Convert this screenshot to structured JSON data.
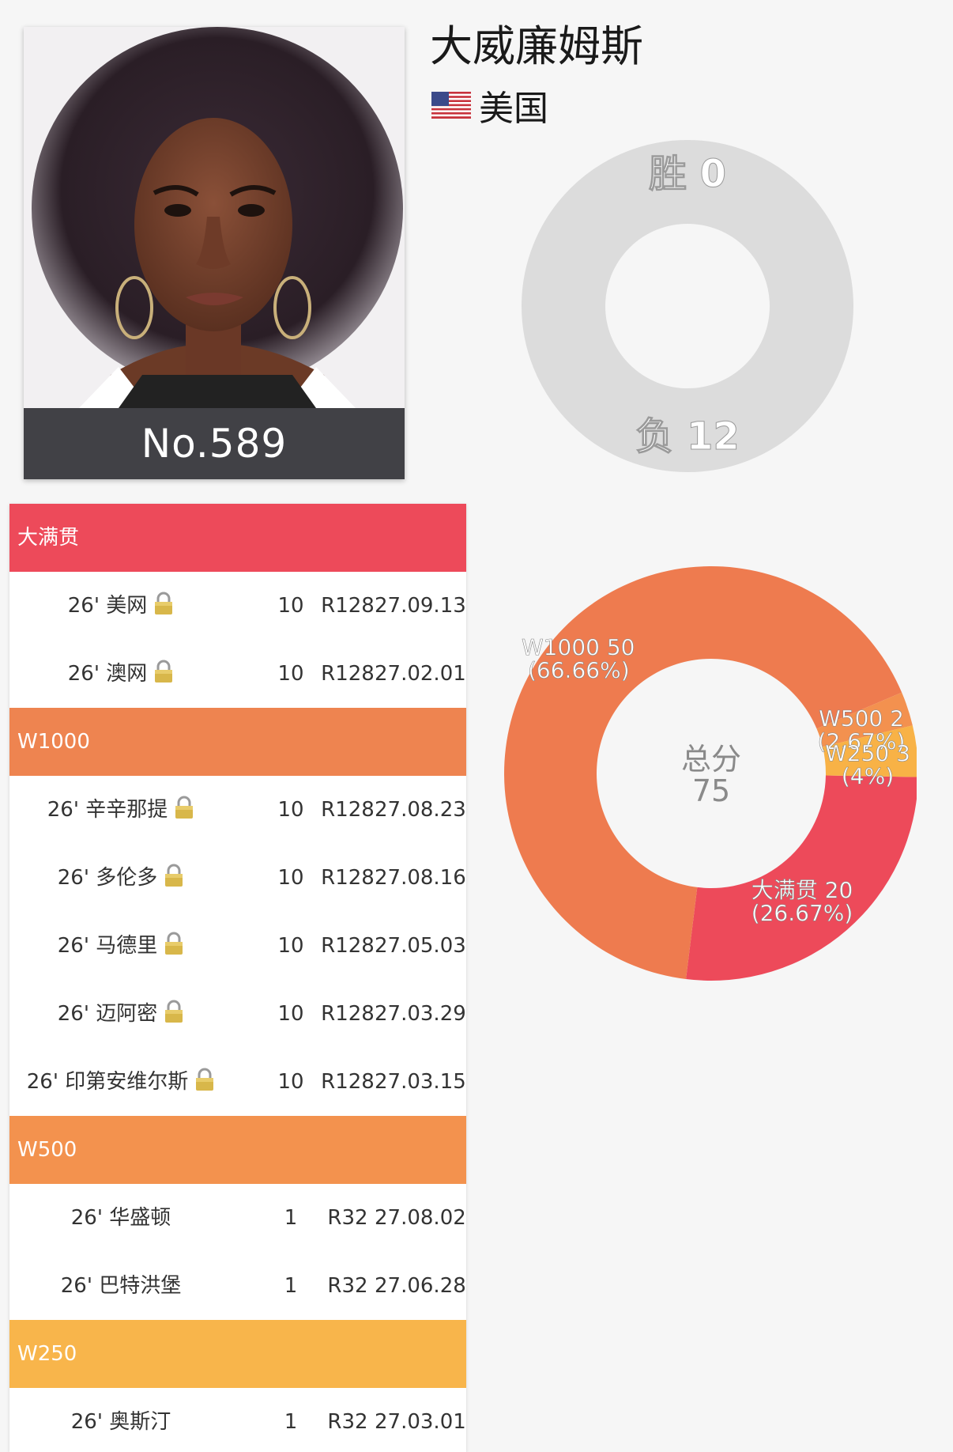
{
  "player": {
    "name": "大威廉姆斯",
    "country": "美国",
    "rank_label": "No.589"
  },
  "record": {
    "wins_label": "胜 0",
    "losses_label": "负 12",
    "wins": 0,
    "losses": 12,
    "color": "#dcdcdc"
  },
  "points_chart": {
    "center_label": "总分",
    "center_value": "75"
  },
  "chart_data": {
    "type": "pie",
    "center_label": "总分",
    "center_value": "75",
    "slices": [
      {
        "name": "W1000",
        "value": 50,
        "label": "W1000 50",
        "pct": "(66.66%)",
        "color": "#ee7b4f"
      },
      {
        "name": "W500",
        "value": 2,
        "label": "W500 2",
        "pct": "(2.67%)",
        "color": "#f3914f"
      },
      {
        "name": "W250",
        "value": 3,
        "label": "W250 3",
        "pct": "(4%)",
        "color": "#f8b246"
      },
      {
        "name": "大满贯",
        "value": 20,
        "label": "大满贯 20",
        "pct": "(26.67%)",
        "color": "#ed4a5a"
      }
    ]
  },
  "categories": [
    {
      "name": "大满贯",
      "color": "#ed4a5a",
      "rows": [
        {
          "name": "26' 美网",
          "points": "10",
          "round": "R128",
          "date": "27.09.13"
        },
        {
          "name": "26' 澳网",
          "points": "10",
          "round": "R128",
          "date": "27.02.01"
        }
      ]
    },
    {
      "name": "W1000",
      "color": "#ee8450",
      "rows": [
        {
          "name": "26' 辛辛那提",
          "points": "10",
          "round": "R128",
          "date": "27.08.23"
        },
        {
          "name": "26' 多伦多",
          "points": "10",
          "round": "R128",
          "date": "27.08.16"
        },
        {
          "name": "26' 马德里",
          "points": "10",
          "round": "R128",
          "date": "27.05.03"
        },
        {
          "name": "26' 迈阿密",
          "points": "10",
          "round": "R128",
          "date": "27.03.29"
        },
        {
          "name": "26' 印第安维尔斯",
          "points": "10",
          "round": "R128",
          "date": "27.03.15"
        }
      ]
    },
    {
      "name": "W500",
      "color": "#f3924e",
      "rows": [
        {
          "name": "26' 华盛顿",
          "points": "1",
          "round": "R32",
          "date": "27.08.02"
        },
        {
          "name": "26' 巴特洪堡",
          "points": "1",
          "round": "R32",
          "date": "27.06.28"
        }
      ]
    },
    {
      "name": "W250",
      "color": "#f8b54b",
      "rows": [
        {
          "name": "26' 奥斯汀",
          "points": "1",
          "round": "R32",
          "date": "27.03.01"
        }
      ]
    }
  ],
  "icons": {
    "lock": "lock-icon",
    "flag": "us-flag-icon"
  }
}
